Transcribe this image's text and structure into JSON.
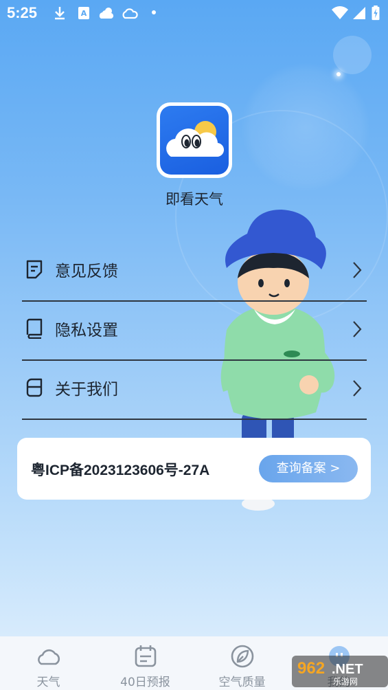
{
  "status_bar": {
    "time": "5:25",
    "icons": [
      "download-icon",
      "translate-icon",
      "weather-icon",
      "cloud-icon",
      "wifi-icon",
      "signal-icon",
      "battery-icon"
    ]
  },
  "app": {
    "name": "即看天气",
    "icon_name": "app-logo-icon"
  },
  "menu": {
    "items": [
      {
        "label": "意见反馈",
        "icon": "feedback-icon"
      },
      {
        "label": "隐私设置",
        "icon": "privacy-book-icon"
      },
      {
        "label": "关于我们",
        "icon": "about-icon"
      }
    ]
  },
  "icp": {
    "text": "粤ICP备2023123606号-27A",
    "button_label": "查询备案 >"
  },
  "bottom_nav": {
    "tabs": [
      {
        "label": "天气",
        "icon": "cloud-icon"
      },
      {
        "label": "40日预报",
        "icon": "calendar-icon"
      },
      {
        "label": "空气质量",
        "icon": "leaf-icon"
      },
      {
        "label": "我的",
        "icon": "profile-icon"
      }
    ]
  },
  "watermark": {
    "text_main": "962.NET",
    "text_sub": "乐游网"
  },
  "colors": {
    "accent": "#69a5ec",
    "text_dark": "#1d2530",
    "nav_text": "#8a939e"
  }
}
